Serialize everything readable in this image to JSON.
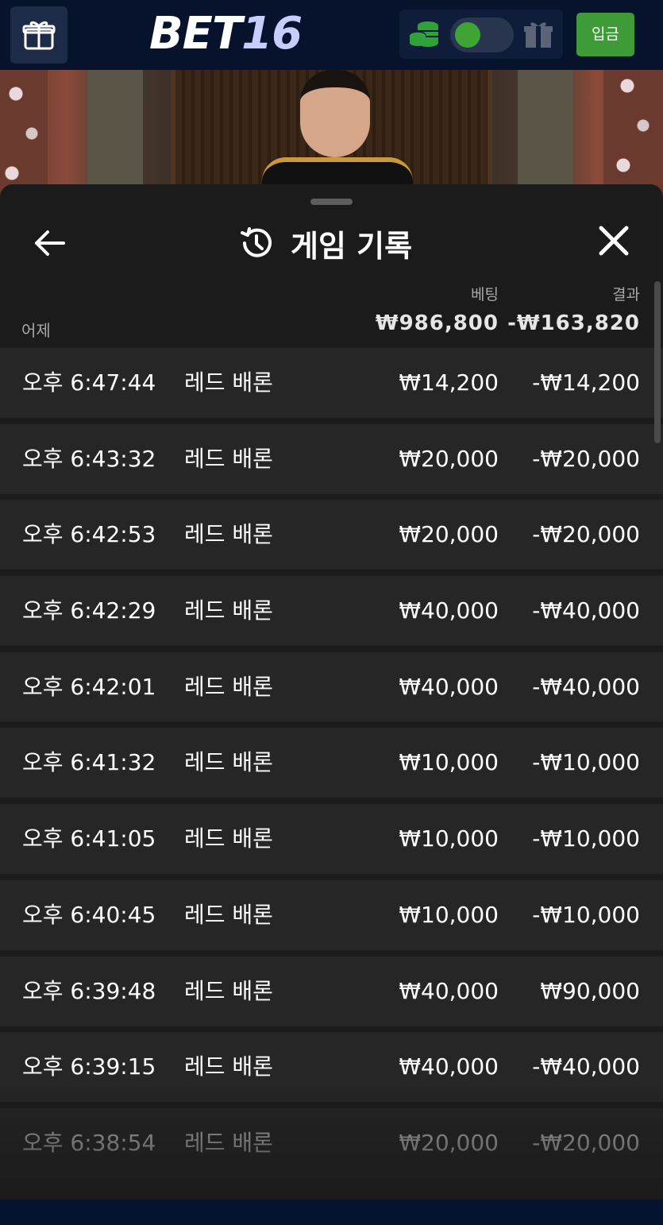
{
  "header": {
    "logo_main": "BET",
    "logo_num": "16",
    "deposit_label": "입금",
    "colors": {
      "accent_green": "#3f9a38",
      "topbar_bg": "#07122c"
    },
    "icons": [
      "gift-icon",
      "coins-icon",
      "toggle",
      "gift-box-icon"
    ]
  },
  "sheet": {
    "title": "게임 기록",
    "icons": [
      "back-arrow-icon",
      "history-icon",
      "close-icon"
    ],
    "columns": {
      "bet": "베팅",
      "result": "결과"
    },
    "day": "어제",
    "totals": {
      "bet": "₩986,800",
      "result": "-₩163,820"
    },
    "rows": [
      {
        "time": "오후 6:47:44",
        "game": "레드 배론",
        "bet": "₩14,200",
        "result": "-₩14,200"
      },
      {
        "time": "오후 6:43:32",
        "game": "레드 배론",
        "bet": "₩20,000",
        "result": "-₩20,000"
      },
      {
        "time": "오후 6:42:53",
        "game": "레드 배론",
        "bet": "₩20,000",
        "result": "-₩20,000"
      },
      {
        "time": "오후 6:42:29",
        "game": "레드 배론",
        "bet": "₩40,000",
        "result": "-₩40,000"
      },
      {
        "time": "오후 6:42:01",
        "game": "레드 배론",
        "bet": "₩40,000",
        "result": "-₩40,000"
      },
      {
        "time": "오후 6:41:32",
        "game": "레드 배론",
        "bet": "₩10,000",
        "result": "-₩10,000"
      },
      {
        "time": "오후 6:41:05",
        "game": "레드 배론",
        "bet": "₩10,000",
        "result": "-₩10,000"
      },
      {
        "time": "오후 6:40:45",
        "game": "레드 배론",
        "bet": "₩10,000",
        "result": "-₩10,000"
      },
      {
        "time": "오후 6:39:48",
        "game": "레드 배론",
        "bet": "₩40,000",
        "result": "₩90,000"
      },
      {
        "time": "오후 6:39:15",
        "game": "레드 배론",
        "bet": "₩40,000",
        "result": "-₩40,000"
      },
      {
        "time": "오후 6:38:54",
        "game": "레드 배론",
        "bet": "₩20,000",
        "result": "-₩20,000"
      }
    ]
  }
}
